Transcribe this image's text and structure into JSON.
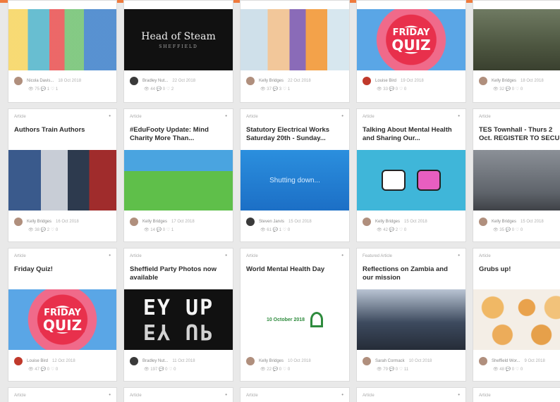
{
  "row1": [
    {
      "author": "Nicola Davis...",
      "date": "18 Oct 2018",
      "stats": "👁 75  💬 1  ♡ 1",
      "thumb_icon": "factory-illustration-image"
    },
    {
      "author": "Bradley Nut...",
      "date": "22 Oct 2018",
      "stats": "👁 44  💬 0  ♡ 2",
      "thumb_heading": "Head of Steam",
      "thumb_sub": "SHEFFIELD",
      "thumb_icon": "head-of-steam-logo-image"
    },
    {
      "author": "Kelly Bridges",
      "date": "22 Oct 2018",
      "stats": "👁 37  💬 3  ♡ 1",
      "thumb_icon": "children-photo-image"
    },
    {
      "author": "Louise Bird",
      "date": "19 Oct 2018",
      "stats": "👁 33  💬 0  ♡ 0",
      "thumb_line1": "FRIDAY",
      "thumb_line2": "QUIZ",
      "thumb_icon": "friday-quiz-image"
    },
    {
      "author": "Kelly Bridges",
      "date": "18 Oct 2018",
      "stats": "👁 32  💬 0  ♡ 0",
      "thumb_icon": "soldiers-photo-image"
    }
  ],
  "row2": [
    {
      "type": "Article",
      "title": "Authors Train Authors",
      "author": "Kelly Bridges",
      "date": "16 Oct 2018",
      "stats": "👁 38  💬 2  ♡ 0",
      "thumb_icon": "authors-photo-image"
    },
    {
      "type": "Article",
      "title": "#EduFooty Update: Mind Charity More Than...",
      "author": "Kelly Bridges",
      "date": "17 Oct 2018",
      "stats": "👁 14  💬 0  ♡ 1",
      "thumb_icon": "football-photo-image"
    },
    {
      "type": "Article",
      "title": "Statutory Electrical Works Saturday 20th - Sunday...",
      "author": "Steven Jarvis",
      "date": "15 Oct 2018",
      "stats": "👁 61  💬 1  ♡ 0",
      "thumb_text": "Shutting down...",
      "thumb_icon": "shutting-down-image"
    },
    {
      "type": "Article",
      "title": "Talking About Mental Health and Sharing Our...",
      "author": "Kelly Bridges",
      "date": "15 Oct 2018",
      "stats": "👁 42  💬 2  ♡ 0",
      "thumb_icon": "feelings-illustration-image"
    },
    {
      "type": "Article",
      "title": "TES Townhall - Thurs 2 Oct. REGISTER TO SECU",
      "author": "Kelly Bridges",
      "date": "15 Oct 2018",
      "stats": "👁 35  💬 0  ♡ 0",
      "thumb_icon": "building-photo-image"
    }
  ],
  "row3": [
    {
      "type": "Article",
      "title": "Friday Quiz!",
      "author": "Louise Bird",
      "date": "12 Oct 2018",
      "stats": "👁 47  💬 0  ♡ 0",
      "thumb_line1": "FRIDAY",
      "thumb_line2": "QUIZ",
      "thumb_icon": "friday-quiz-image"
    },
    {
      "type": "Article",
      "title": "Sheffield Party Photos now available",
      "author": "Bradley Nut...",
      "date": "11 Oct 2018",
      "stats": "👁 197  💬 0  ♡ 0",
      "thumb_line1": "EY UP",
      "thumb_line2": "EY UP",
      "thumb_icon": "ey-up-lettering-image"
    },
    {
      "type": "Article",
      "title": "World Mental Health Day",
      "author": "Kelly Bridges",
      "date": "10 Oct 2018",
      "stats": "👁 22  💬 0  ♡ 0",
      "thumb_text": "10 October 2018",
      "thumb_icon": "mental-health-ribbon-image"
    },
    {
      "type": "Featured Article",
      "title": "Reflections on Zambia and our mission",
      "author": "Sarah Cormack",
      "date": "10 Oct 2018",
      "stats": "👁 79  💬 0  ♡ 11",
      "thumb_icon": "zambia-photo-image"
    },
    {
      "type": "Article",
      "title": "Grubs up!",
      "author": "Sheffield Wor...",
      "date": "9 Oct 2018",
      "stats": "👁 48  💬 0  ♡ 0",
      "thumb_icon": "food-photo-image"
    }
  ],
  "row4": [
    {
      "type": "Article"
    },
    {
      "type": "Article"
    },
    {
      "type": "Article"
    },
    {
      "type": "Article"
    },
    {
      "type": "Article"
    }
  ],
  "menu_glyph": "•",
  "colors": {
    "accent": "#ef7a3c",
    "card_bg": "#ffffff",
    "page_bg": "#e9e9e9",
    "title": "#2c2c2c"
  }
}
